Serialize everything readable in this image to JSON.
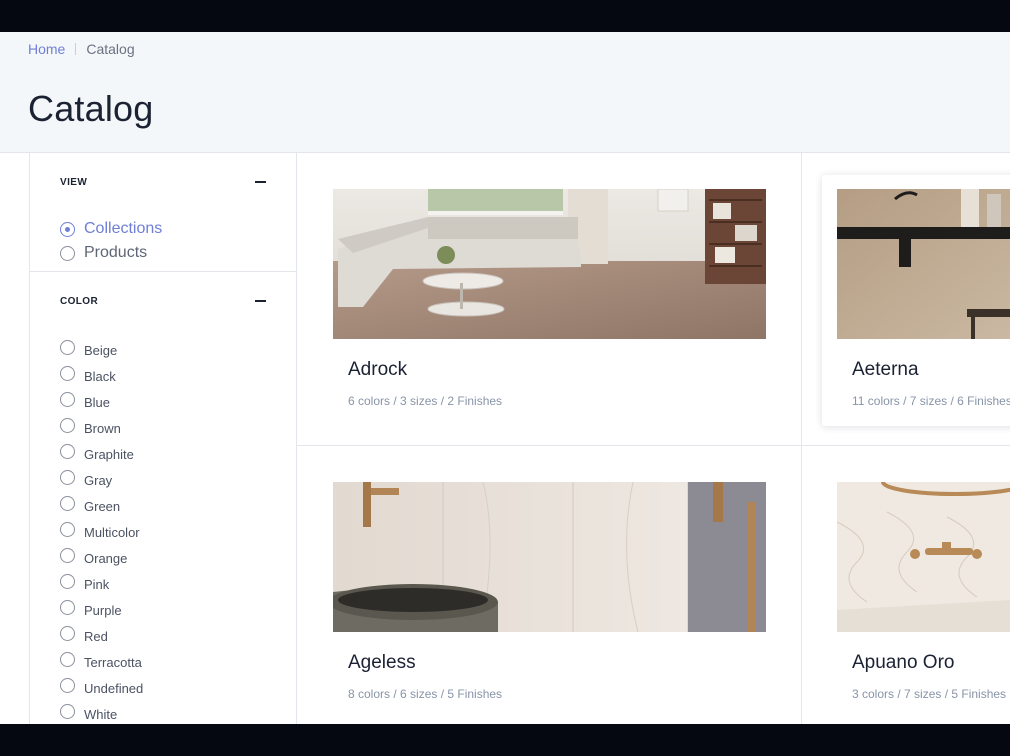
{
  "breadcrumb": {
    "home": "Home",
    "current": "Catalog"
  },
  "page": {
    "title": "Catalog"
  },
  "sidebar": {
    "view": {
      "title": "VIEW",
      "options": [
        {
          "label": "Collections",
          "checked": true
        },
        {
          "label": "Products",
          "checked": false
        }
      ]
    },
    "color": {
      "title": "COLOR",
      "options": [
        "Beige",
        "Black",
        "Blue",
        "Brown",
        "Graphite",
        "Gray",
        "Green",
        "Multicolor",
        "Orange",
        "Pink",
        "Purple",
        "Red",
        "Terracotta",
        "Undefined",
        "White"
      ]
    }
  },
  "collections": [
    {
      "name": "Adrock",
      "meta": "6 colors / 3 sizes / 2 Finishes",
      "image": "living-room-image"
    },
    {
      "name": "Aeterna",
      "meta": "11 colors / 7 sizes / 6 Finishes",
      "image": "bathroom-shelf-image"
    },
    {
      "name": "Ageless",
      "meta": "8 colors / 6 sizes / 5 Finishes",
      "image": "marble-basin-image"
    },
    {
      "name": "Apuano Oro",
      "meta": "3 colors / 7 sizes / 5 Finishes",
      "image": "gold-faucet-image"
    }
  ],
  "colors": {
    "accent": "#6f7fd6",
    "text": "#1b2233",
    "muted": "#8894a8",
    "border": "#e3e7ec",
    "header_bg": "#f4f7fa"
  }
}
